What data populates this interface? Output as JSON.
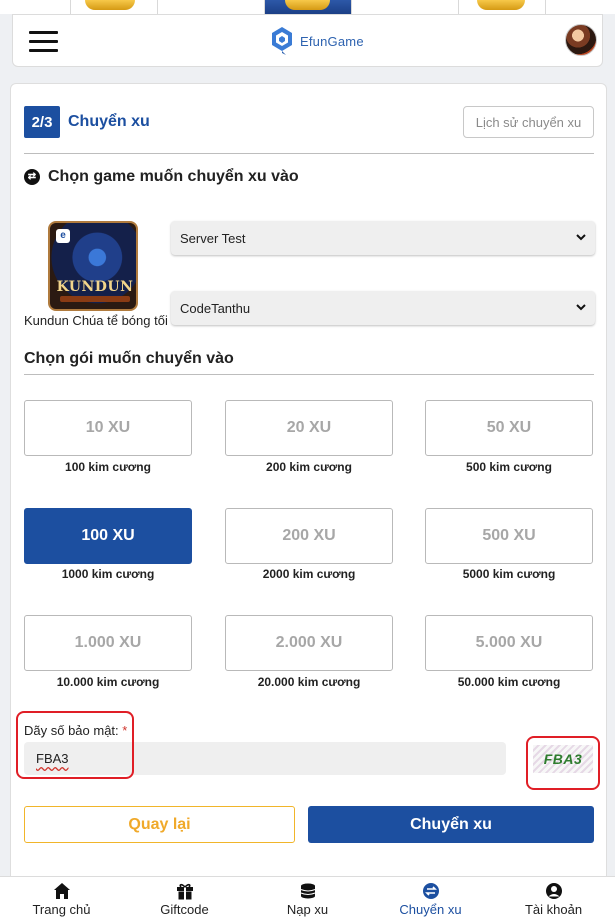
{
  "brand": {
    "name": "EfunGame",
    "accent": "#1c4fa0",
    "warning": "#f0a92a",
    "required": "#d0342c"
  },
  "header": {
    "menu_icon": "hamburger-icon",
    "avatar": "user-avatar"
  },
  "transfer": {
    "step": "2/3",
    "title": "Chuyển xu",
    "history_label": "Lịch sử chuyển xu",
    "choose_game_label": "Chọn game muốn chuyển xu vào",
    "game_name": "Kundun Chúa tể bóng tối",
    "game_logo_text": "KUNDUN",
    "server_selected": "Server Test",
    "character_selected": "CodeTanthu",
    "choose_package_label": "Chọn gói muốn chuyển vào",
    "packages": [
      {
        "xu": "10 XU",
        "diamonds": "100 kim cương",
        "selected": false
      },
      {
        "xu": "20 XU",
        "diamonds": "200 kim cương",
        "selected": false
      },
      {
        "xu": "50 XU",
        "diamonds": "500 kim cương",
        "selected": false
      },
      {
        "xu": "100 XU",
        "diamonds": "1000 kim cương",
        "selected": true
      },
      {
        "xu": "200 XU",
        "diamonds": "2000 kim cương",
        "selected": false
      },
      {
        "xu": "500 XU",
        "diamonds": "5000 kim cương",
        "selected": false
      },
      {
        "xu": "1.000 XU",
        "diamonds": "10.000 kim cương",
        "selected": false
      },
      {
        "xu": "2.000 XU",
        "diamonds": "20.000 kim cương",
        "selected": false
      },
      {
        "xu": "5.000 XU",
        "diamonds": "50.000 kim cương",
        "selected": false
      }
    ],
    "security_label": "Dãy số bảo mật:",
    "security_required_mark": "*",
    "security_value": "FBA3",
    "captcha_text": "FBA3",
    "back_label": "Quay lại",
    "submit_label": "Chuyển xu"
  },
  "bottom_nav": [
    {
      "label": "Trang chủ",
      "icon": "home-icon",
      "active": false
    },
    {
      "label": "Giftcode",
      "icon": "gift-icon",
      "active": false
    },
    {
      "label": "Nạp xu",
      "icon": "coins-icon",
      "active": false
    },
    {
      "label": "Chuyển xu",
      "icon": "transfer-icon",
      "active": true
    },
    {
      "label": "Tài khoản",
      "icon": "account-icon",
      "active": false
    }
  ]
}
